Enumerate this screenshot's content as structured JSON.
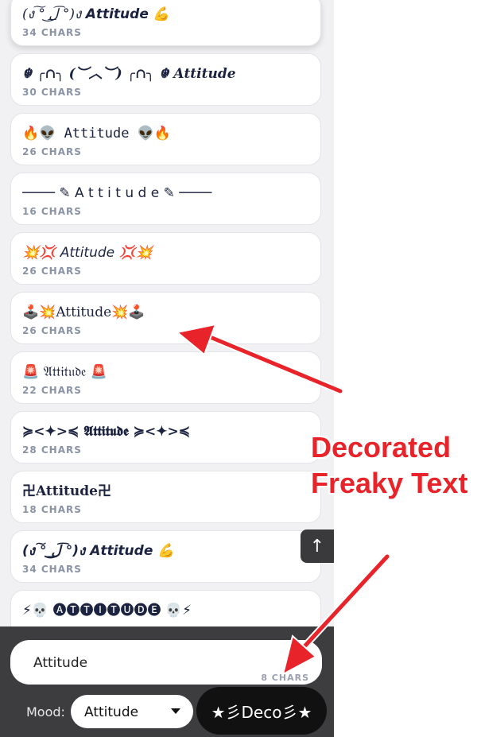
{
  "results": [
    {
      "text": "(ง ͠° ͟ل͜ ͡°)ง 𝘼𝙩𝙩𝙞𝙩𝙪𝙙𝙚 💪",
      "count": "34 CHARS",
      "style": "serif italic"
    },
    {
      "text": "☬ ╭∩╮ (︶︿︶) ╭∩╮ ☬ 𝑨𝒕𝒕𝒊𝒕𝒖𝒅𝒆",
      "count": "30 CHARS",
      "style": "serif bold italic"
    },
    {
      "text": "🔥👽 Attitude 👽🔥",
      "count": "26 CHARS",
      "style": "mono"
    },
    {
      "text": "──── ✎ A t t i t u d e ✎ ────",
      "count": "16 CHARS",
      "style": ""
    },
    {
      "text": "💥💢 Attitude 💢💥",
      "count": "26 CHARS",
      "style": "italic"
    },
    {
      "text": "🕹️💥Attitude💥🕹️",
      "count": "26 CHARS",
      "style": "serif"
    },
    {
      "text": "🚨 𝔄𝔱𝔱𝔦𝔱𝔲𝔡𝔢 🚨",
      "count": "22 CHARS",
      "style": "serif"
    },
    {
      "text": "≽<✦>≼ 𝕬𝖙𝖙𝖎𝖙𝖚𝖉𝖊 ≽<✦>≼",
      "count": "28 CHARS",
      "style": "serif bold"
    },
    {
      "text": "卍Attitude卍",
      "count": "18 CHARS",
      "style": "serif bold"
    },
    {
      "text": "(ง ͠° ͟ل͜ ͡°)ง 𝘼𝙩𝙩𝙞𝙩𝙪𝙙𝙚 💪",
      "count": "34 CHARS",
      "style": "bold italic"
    },
    {
      "text": "⚡💀 🅐🅣🅣🅘🅣🅤🅓🅔 💀⚡",
      "count": "",
      "style": ""
    }
  ],
  "scroll_top_label": "↑",
  "input": {
    "value": "Attitude",
    "count": "8 CHARS"
  },
  "mood": {
    "label": "Mood:",
    "value": "Attitude"
  },
  "deco_button": "★彡Deco彡★",
  "annotation": {
    "line1": "Decorated",
    "line2": "Freaky Text"
  },
  "colors": {
    "annotation": "#e8232a",
    "bottom_bar": "#3d3d3f",
    "card_count": "#8a93a6"
  }
}
